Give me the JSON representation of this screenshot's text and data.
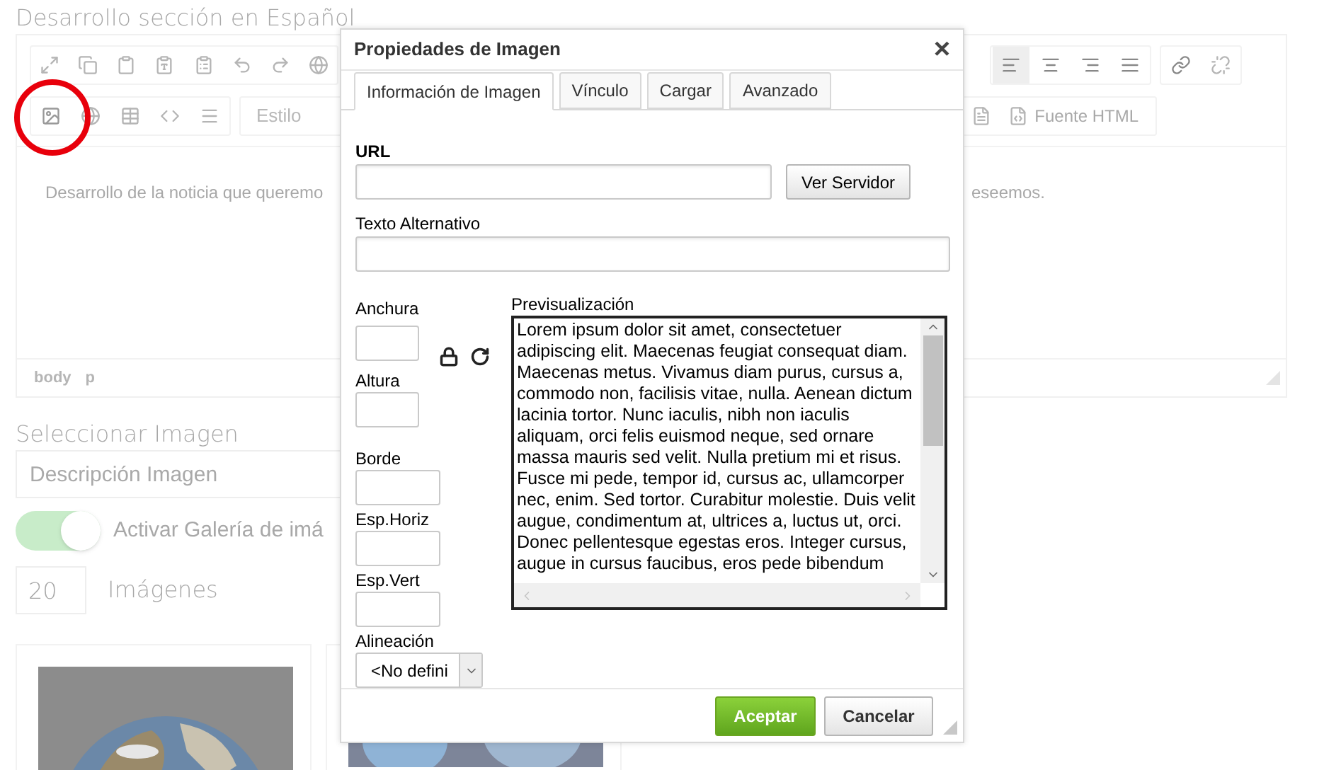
{
  "page": {
    "section_title": "Desarrollo sección en Español",
    "editor": {
      "style_placeholder": "Estilo",
      "source_button": "Fuente HTML",
      "alignment_buttons": [
        {
          "selected": true
        },
        {
          "selected": false
        },
        {
          "selected": false
        },
        {
          "selected": false
        }
      ],
      "content_left": "Desarrollo de la noticia que queremo",
      "content_right": "eseemos.",
      "path": [
        "body",
        "p"
      ]
    },
    "image_section": {
      "title": "Seleccionar Imagen",
      "description_placeholder": "Descripción Imagen",
      "gallery_toggle": {
        "label": "Activar Galería de imá",
        "on": true
      },
      "count": {
        "value": "20",
        "label": "Imágenes"
      }
    }
  },
  "dialog": {
    "title": "Propiedades de Imagen",
    "close": "×",
    "tabs": [
      {
        "label": "Información de Imagen",
        "selected": true
      },
      {
        "label": "Vínculo",
        "selected": false
      },
      {
        "label": "Cargar",
        "selected": false
      },
      {
        "label": "Avanzado",
        "selected": false
      }
    ],
    "url_label": "URL",
    "browse_button": "Ver Servidor",
    "alt_label": "Texto Alternativo",
    "fields": [
      {
        "label": "Anchura"
      },
      {
        "label": "Altura"
      },
      {
        "label": "Borde"
      },
      {
        "label": "Esp.Horiz"
      },
      {
        "label": "Esp.Vert"
      }
    ],
    "align_label": "Alineación",
    "align_value": "<No defini",
    "preview_label": "Previsualización",
    "preview_lines": [
      "Lorem ipsum dolor sit amet, consectetuer",
      "adipiscing elit. Maecenas feugiat consequat diam.",
      "Maecenas metus. Vivamus diam purus, cursus a,",
      "commodo non, facilisis vitae, nulla. Aenean dictum",
      "lacinia tortor. Nunc iaculis, nibh non iaculis",
      "aliquam, orci felis euismod neque, sed ornare",
      "massa mauris sed velit. Nulla pretium mi et risus.",
      "Fusce mi pede, tempor id, cursus ac, ullamcorper",
      "nec, enim. Sed tortor. Curabitur molestie. Duis velit",
      "augue, condimentum at, ultrices a, luctus ut, orci.",
      "Donec pellentesque egestas eros. Integer cursus,",
      "augue in cursus faucibus, eros pede bibendum"
    ],
    "ok_button": "Aceptar",
    "cancel_button": "Cancelar"
  }
}
